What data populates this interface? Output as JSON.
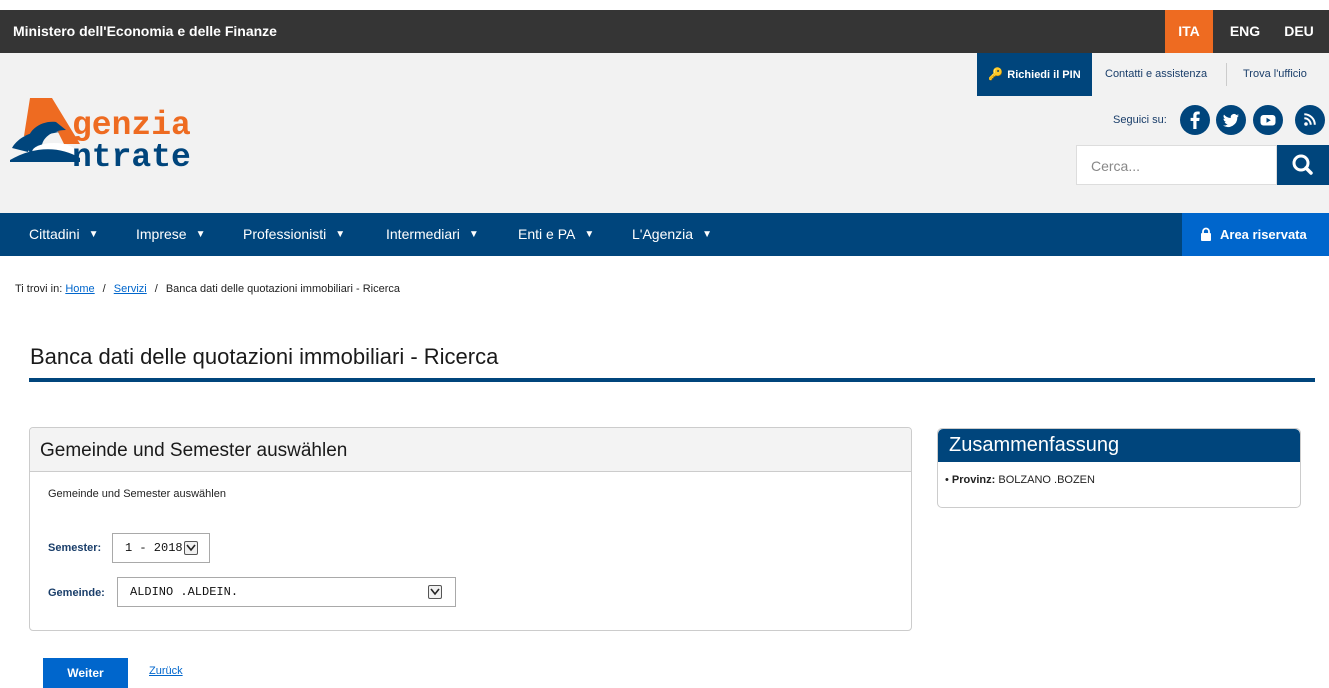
{
  "topbar": {
    "ministry": "Ministero dell'Economia e delle Finanze",
    "languages": [
      {
        "label": "ITA",
        "active": true
      },
      {
        "label": "ENG",
        "active": false
      },
      {
        "label": "DEU",
        "active": false
      }
    ],
    "active_color": "#ee6b21",
    "bg_color": "#353535"
  },
  "header": {
    "logo": {
      "line1": "genzia",
      "line2": "ntrate",
      "icon": "agenzia-entrate-logo"
    },
    "pin_button": "Richiedi il PIN",
    "contacts_link": "Contatti e assistenza",
    "office_link": "Trova l'ufficio",
    "follow_label": "Seguici su:",
    "social": [
      "facebook-icon",
      "twitter-icon",
      "youtube-icon",
      "rss-icon"
    ],
    "search_placeholder": "Cerca..."
  },
  "nav": {
    "items": [
      {
        "label": "Cittadini"
      },
      {
        "label": "Imprese"
      },
      {
        "label": "Professionisti"
      },
      {
        "label": "Intermediari"
      },
      {
        "label": "Enti e PA"
      },
      {
        "label": "L'Agenzia"
      }
    ],
    "area_riservata": "Area riservata",
    "bg_color": "#00457c",
    "area_color": "#0066cc"
  },
  "breadcrumb": {
    "prefix": "Ti trovi in:",
    "items": [
      "Home",
      "Servizi",
      "Banca dati delle quotazioni immobiliari - Ricerca"
    ]
  },
  "page": {
    "title": "Banca dati delle quotazioni immobiliari - Ricerca"
  },
  "form_panel": {
    "title": "Gemeinde und Semester auswählen",
    "description": "Gemeinde und Semester auswählen",
    "semester_label": "Semester:",
    "semester_value": "1 - 2018",
    "gemeinde_label": "Gemeinde:",
    "gemeinde_value": "ALDINO .ALDEIN."
  },
  "summary": {
    "title": "Zusammenfassung",
    "province_label": "Provinz:",
    "province_value": "BOLZANO .BOZEN"
  },
  "actions": {
    "next": "Weiter",
    "back": "Zurück"
  }
}
